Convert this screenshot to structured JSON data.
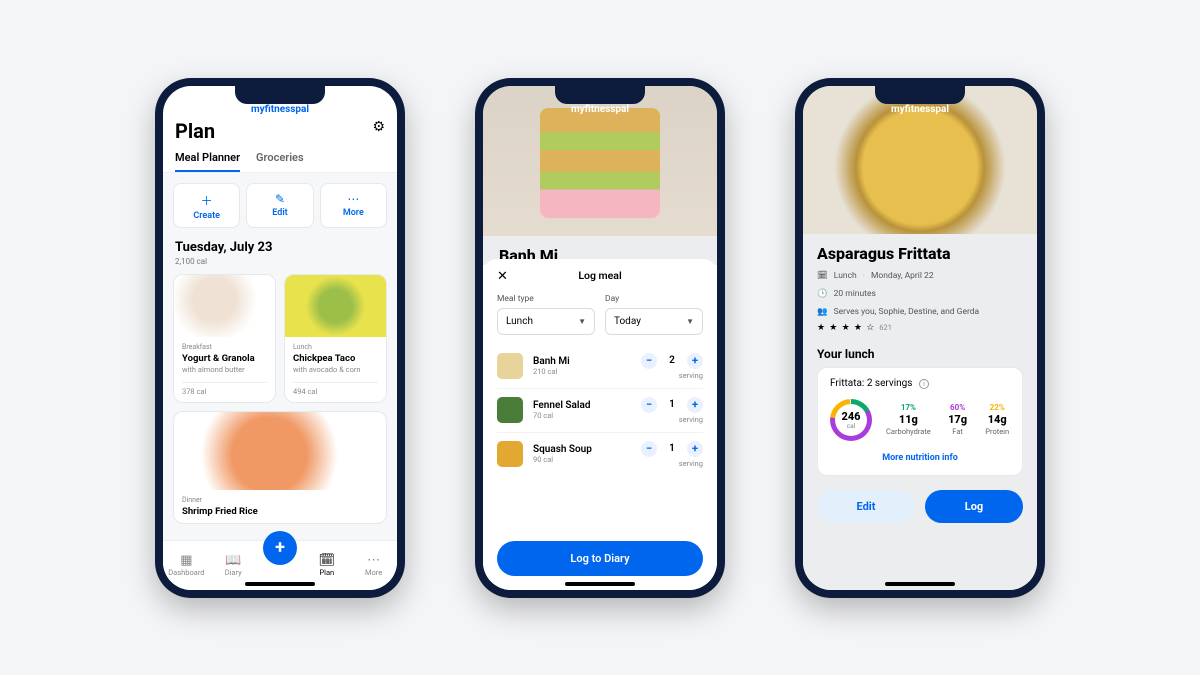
{
  "brand": "myfitnesspal",
  "phone1": {
    "title": "Plan",
    "tabs": {
      "active": "Meal Planner",
      "other": "Groceries"
    },
    "quick": {
      "create": "Create",
      "edit": "Edit",
      "more": "More"
    },
    "date": "Tuesday, July 23",
    "total_cal": "2,100 cal",
    "cards": [
      {
        "meal": "Breakfast",
        "title": "Yogurt & Granola",
        "sub": "with almond butter",
        "cal": "378 cal"
      },
      {
        "meal": "Lunch",
        "title": "Chickpea Taco",
        "sub": "with avocado & corn",
        "cal": "494 cal"
      }
    ],
    "card3": {
      "meal": "Dinner",
      "title": "Shrimp Fried Rice"
    },
    "nav": {
      "dashboard": "Dashboard",
      "diary": "Diary",
      "plan": "Plan",
      "more": "More"
    }
  },
  "phone2": {
    "hero_title": "Banh Mi",
    "sheet_title": "Log meal",
    "labels": {
      "meal_type": "Meal type",
      "day": "Day"
    },
    "selects": {
      "meal_type": "Lunch",
      "day": "Today"
    },
    "items": [
      {
        "name": "Banh Mi",
        "cal": "210 cal",
        "qty": "2",
        "unit": "serving"
      },
      {
        "name": "Fennel Salad",
        "cal": "70 cal",
        "qty": "1",
        "unit": "serving"
      },
      {
        "name": "Squash Soup",
        "cal": "90 cal",
        "qty": "1",
        "unit": "serving"
      }
    ],
    "cta": "Log to Diary"
  },
  "phone3": {
    "title": "Asparagus Frittata",
    "meta": {
      "meal": "Lunch",
      "date": "Monday, April 22",
      "duration": "20 minutes",
      "serves": "Serves you, Sophie, Destine, and Gerda"
    },
    "rating": {
      "stars": "★ ★ ★ ★ ☆",
      "count": "621"
    },
    "section": "Your lunch",
    "panel": {
      "header": "Frittata: 2 servings",
      "calories": "246",
      "cal_unit": "cal",
      "macros": [
        {
          "pct": "17%",
          "g": "11g",
          "name": "Carbohydrate"
        },
        {
          "pct": "60%",
          "g": "17g",
          "name": "Fat"
        },
        {
          "pct": "22%",
          "g": "14g",
          "name": "Protein"
        }
      ],
      "more": "More nutrition info"
    },
    "buttons": {
      "edit": "Edit",
      "log": "Log"
    }
  }
}
